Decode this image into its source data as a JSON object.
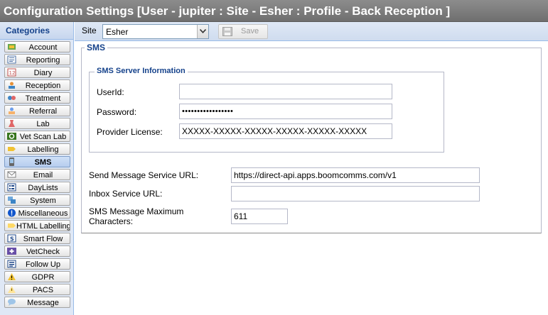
{
  "window": {
    "title": "Configuration Settings [User - jupiter : Site - Esher : Profile - Back Reception ]"
  },
  "sidebar": {
    "header": "Categories",
    "items": [
      {
        "label": "Account",
        "icon": "account-icon"
      },
      {
        "label": "Reporting",
        "icon": "reporting-icon"
      },
      {
        "label": "Diary",
        "icon": "diary-icon"
      },
      {
        "label": "Reception",
        "icon": "reception-icon"
      },
      {
        "label": "Treatment",
        "icon": "treatment-icon"
      },
      {
        "label": "Referral",
        "icon": "referral-icon"
      },
      {
        "label": "Lab",
        "icon": "lab-icon"
      },
      {
        "label": "Vet Scan Lab",
        "icon": "vet-scan-lab-icon"
      },
      {
        "label": "Labelling",
        "icon": "labelling-icon"
      },
      {
        "label": "SMS",
        "icon": "sms-icon"
      },
      {
        "label": "Email",
        "icon": "email-icon"
      },
      {
        "label": "DayLists",
        "icon": "daylists-icon"
      },
      {
        "label": "System",
        "icon": "system-icon"
      },
      {
        "label": "Miscellaneous",
        "icon": "miscellaneous-icon"
      },
      {
        "label": "HTML Labelling",
        "icon": "html-labelling-icon"
      },
      {
        "label": "Smart Flow",
        "icon": "smart-flow-icon"
      },
      {
        "label": "VetCheck",
        "icon": "vetcheck-icon"
      },
      {
        "label": "Follow Up",
        "icon": "follow-up-icon"
      },
      {
        "label": "GDPR",
        "icon": "gdpr-icon"
      },
      {
        "label": "PACS",
        "icon": "pacs-icon"
      },
      {
        "label": "Message",
        "icon": "message-icon"
      }
    ],
    "active_item": "SMS"
  },
  "toolbar": {
    "site_label": "Site",
    "site_value": "Esher",
    "save_label": "Save"
  },
  "sms": {
    "legend": "SMS",
    "server_info": {
      "legend": "SMS Server Information",
      "userid_label": "UserId:",
      "userid_value": "",
      "password_label": "Password:",
      "password_value": "•••••••••••••••••",
      "license_label": "Provider License:",
      "license_value": "XXXXX-XXXXX-XXXXX-XXXXX-XXXXX-XXXXX"
    },
    "send_url_label": "Send Message Service URL:",
    "send_url_value": "https://direct-api.apps.boomcomms.com/v1",
    "inbox_url_label": "Inbox Service URL:",
    "inbox_url_value": "",
    "max_chars_label_line1": "SMS Message Maximum",
    "max_chars_label_line2": "Characters:",
    "max_chars_value": "611"
  },
  "colors": {
    "title_bar": "#7a7a7a",
    "panel_bg": "#dfe8f6",
    "legend_text": "#15428b",
    "border": "#99bbe8"
  }
}
